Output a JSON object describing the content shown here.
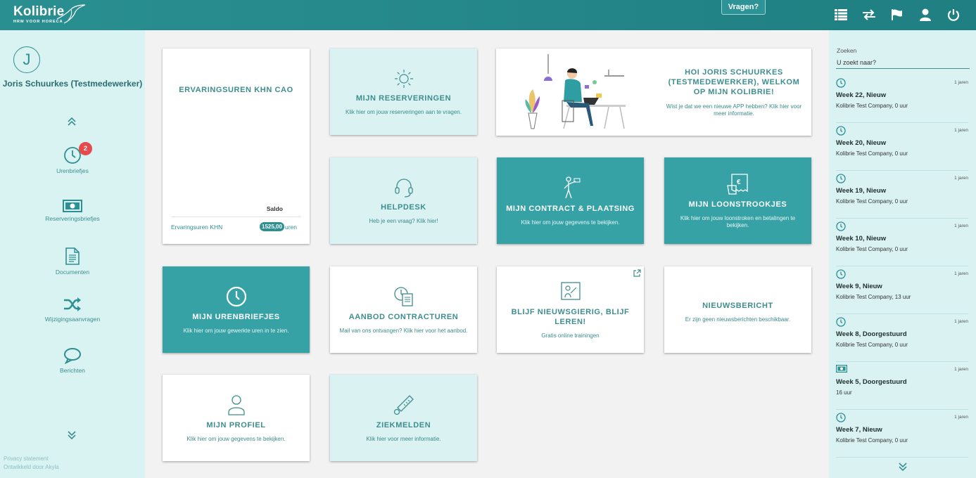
{
  "brand": {
    "name": "Kolibrie",
    "tagline": "HRM VOOR HORECA"
  },
  "header": {
    "help_button": "Vragen?",
    "icons": [
      "list-icon",
      "swap-icon",
      "flag-icon",
      "user-icon",
      "power-icon"
    ]
  },
  "user": {
    "initial": "J",
    "name": "Joris Schuurkes (Testmedewerker)"
  },
  "sidebar": {
    "items": [
      {
        "label": "Urenbriefjes",
        "icon": "clock-icon",
        "badge": "2"
      },
      {
        "label": "Reserveringsbriefjes",
        "icon": "banknote-icon"
      },
      {
        "label": "Documenten",
        "icon": "documents-icon"
      },
      {
        "label": "Wijzigingsaanvragen",
        "icon": "shuffle-icon"
      },
      {
        "label": "Berichten",
        "icon": "chat-icon"
      }
    ],
    "privacy": "Privacy statement",
    "developer": "Ontwikkeld door Akyla"
  },
  "ervaringsuren": {
    "title": "ERVARINGSUREN KHN CAO",
    "saldo_label": "Saldo",
    "row_label": "Ervaringsuren KHN",
    "row_value": "1525,00",
    "row_unit": "uren"
  },
  "welcome": {
    "title": "HOI JORIS SCHUURKES (TESTMEDEWERKER), WELKOM OP MIJN KOLIBRIE!",
    "text": "Wist je dat we een nieuwe APP hebben? Klik hier voor meer informatie."
  },
  "tiles": {
    "reserveringen": {
      "title": "MIJN RESERVERINGEN",
      "text": "Klik hier om jouw reserveringen aan te vragen."
    },
    "helpdesk": {
      "title": "HELPDESK",
      "text": "Heb je een vraag? Klik hier!"
    },
    "contract": {
      "title": "MIJN CONTRACT & PLAATSING",
      "text": "Klik hier om jouw gegevens te bekijken."
    },
    "loonstrookjes": {
      "title": "MIJN LOONSTROOKJES",
      "text": "Klik hier om jouw loonstroken en betalingen te bekijken."
    },
    "urenbriefjes": {
      "title": "MIJN URENBRIEFJES",
      "text": "Klik hier om jouw gewerkte uren in te zien."
    },
    "contracturen": {
      "title": "AANBOD CONTRACTUREN",
      "text": "Mail van ons ontvangen? Klik hier voor het aanbod."
    },
    "leren": {
      "title": "BLIJF NIEUWSGIERIG, BLIJF LEREN!",
      "text": "Gratis online trainingen"
    },
    "nieuws": {
      "title": "NIEUWSBERICHT",
      "text": "Er zijn geen nieuwsberichten beschikbaar."
    },
    "profiel": {
      "title": "MIJN PROFIEL",
      "text": "Klik hier om jouw gegevens te bekijken."
    },
    "ziekmelden": {
      "title": "ZIEKMELDEN",
      "text": "Klik hier voor meer informatie."
    }
  },
  "search": {
    "label": "Zoeken",
    "placeholder": "U zoekt naar?"
  },
  "feed": [
    {
      "icon": "clock-icon",
      "age": "1 jaren",
      "title": "Week 22, Nieuw",
      "sub": "Kolibrie Test Company, 0 uur"
    },
    {
      "icon": "clock-icon",
      "age": "1 jaren",
      "title": "Week 20, Nieuw",
      "sub": "Kolibrie Test Company, 0 uur"
    },
    {
      "icon": "clock-icon",
      "age": "1 jaren",
      "title": "Week 19, Nieuw",
      "sub": "Kolibrie Test Company, 0 uur"
    },
    {
      "icon": "clock-icon",
      "age": "1 jaren",
      "title": "Week 10, Nieuw",
      "sub": "Kolibrie Test Company, 0 uur"
    },
    {
      "icon": "clock-icon",
      "age": "1 jaren",
      "title": "Week 9, Nieuw",
      "sub": "Kolibrie Test Company, 13 uur"
    },
    {
      "icon": "clock-icon",
      "age": "1 jaren",
      "title": "Week 8, Doorgestuurd",
      "sub": "Kolibrie Test Company, 0 uur"
    },
    {
      "icon": "banknote-icon",
      "age": "1 jaren",
      "title": "Week 5, Doorgestuurd",
      "sub": "16 uur"
    },
    {
      "icon": "clock-icon",
      "age": "1 jaren",
      "title": "Week 7, Nieuw",
      "sub": "Kolibrie Test Company, 0 uur"
    }
  ],
  "colors": {
    "topbar": "#1f7f82",
    "accent": "#36a2a6",
    "light_tile": "#daf2f2",
    "badge": "#e64b4b"
  }
}
